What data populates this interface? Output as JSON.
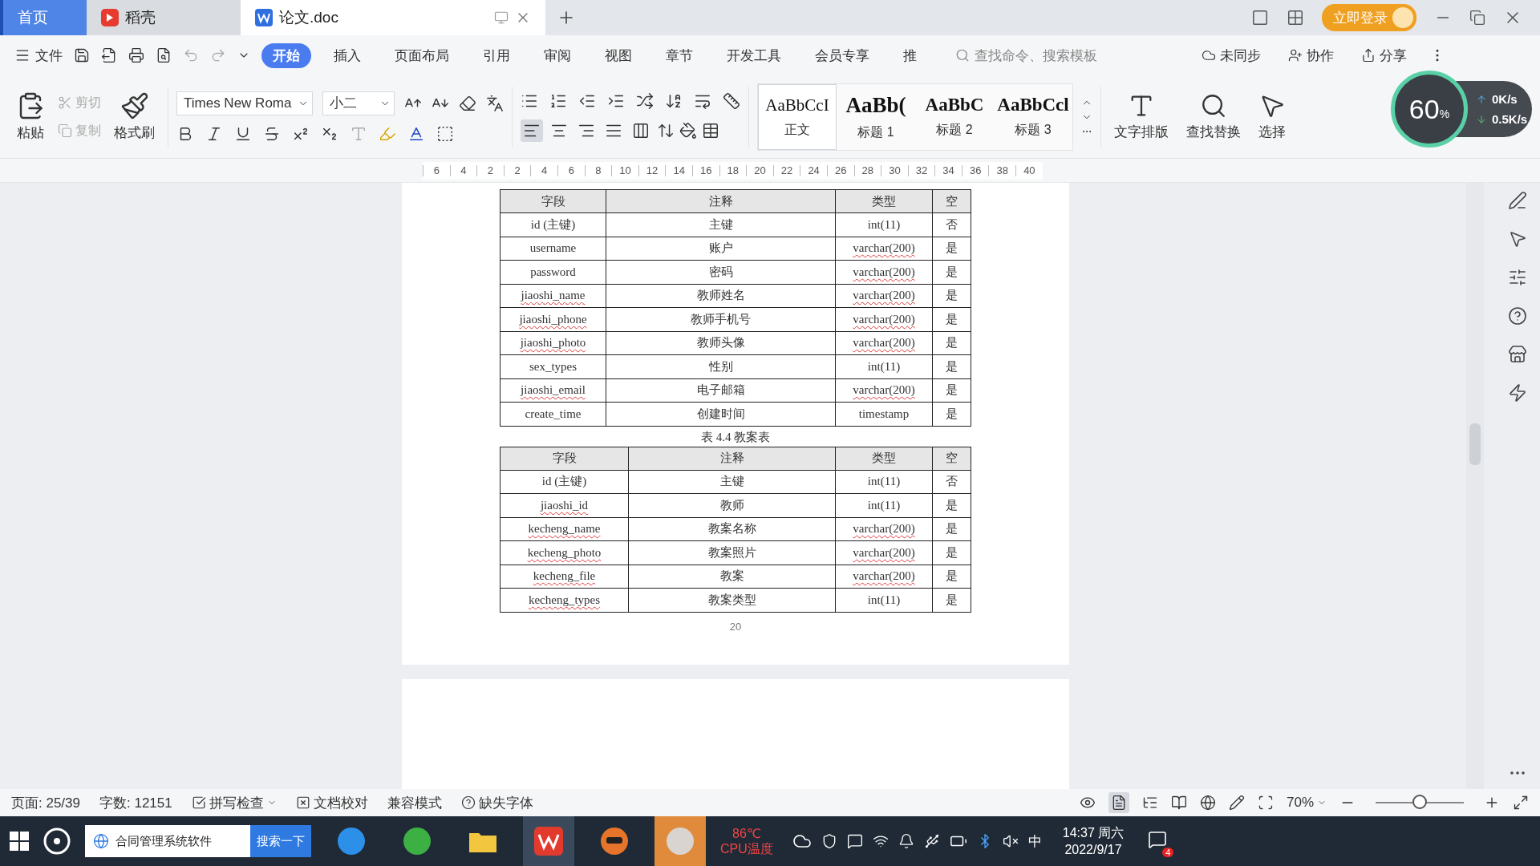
{
  "tabs": [
    {
      "label": "首页",
      "kind": "home",
      "selected": false
    },
    {
      "label": "稻壳",
      "kind": "app",
      "selected": false
    },
    {
      "label": "论文.doc",
      "kind": "doc",
      "selected": true
    }
  ],
  "login_button": "立即登录",
  "menu": {
    "file": "文件",
    "tabs": [
      {
        "label": "开始",
        "selected": true
      },
      {
        "label": "插入",
        "selected": false
      },
      {
        "label": "页面布局",
        "selected": false
      },
      {
        "label": "引用",
        "selected": false
      },
      {
        "label": "审阅",
        "selected": false
      },
      {
        "label": "视图",
        "selected": false
      },
      {
        "label": "章节",
        "selected": false
      },
      {
        "label": "开发工具",
        "selected": false
      },
      {
        "label": "会员专享",
        "selected": false
      },
      {
        "label": "推",
        "selected": false
      }
    ],
    "search_placeholder": "查找命令、搜索模板",
    "actions": [
      "未同步",
      "协作",
      "分享"
    ]
  },
  "ribbon": {
    "paste": "粘贴",
    "clipboard": [
      {
        "label": "剪切",
        "kind": "cut",
        "disabled": true
      },
      {
        "label": "复制",
        "kind": "copy",
        "disabled": true
      }
    ],
    "format_painter": "格式刷",
    "font": "Times New Roma",
    "size": "小二",
    "alignment": [
      {
        "kind": "left",
        "selected": true
      },
      {
        "kind": "center",
        "selected": false
      },
      {
        "kind": "right",
        "selected": false
      },
      {
        "kind": "justify",
        "selected": false
      },
      {
        "kind": "distributed",
        "selected": false
      }
    ],
    "styles": [
      {
        "preview": "AaBbCcI",
        "label": "正文",
        "selected": true
      },
      {
        "preview": "AaBb(",
        "label": "标题 1",
        "selected": false
      },
      {
        "preview": "AaBbC",
        "label": "标题 2",
        "selected": false
      },
      {
        "preview": "AaBbCcl",
        "label": "标题 3",
        "selected": false
      }
    ],
    "big_buttons": [
      {
        "label": "文字排版",
        "kind": "layout"
      },
      {
        "label": "查找替换",
        "kind": "find"
      },
      {
        "label": "选择",
        "kind": "select"
      }
    ]
  },
  "net_widget": {
    "percent": "60",
    "unit": "%",
    "up": "0K/s",
    "down": "0.5K/s"
  },
  "ruler": [
    "6",
    "4",
    "2",
    "2",
    "4",
    "6",
    "8",
    "10",
    "12",
    "14",
    "16",
    "18",
    "20",
    "22",
    "24",
    "26",
    "28",
    "30",
    "32",
    "34",
    "36",
    "38",
    "40"
  ],
  "tables": [
    {
      "header": [
        "字段",
        "注释",
        "类型",
        "空"
      ],
      "rows": [
        {
          "field": "id (主键)",
          "field_flagged": false,
          "note": "主键",
          "type": "int(11)",
          "type_flagged": false,
          "nullable": "否"
        },
        {
          "field": "username",
          "field_flagged": false,
          "note": "账户",
          "type": "varchar(200)",
          "type_flagged": true,
          "nullable": "是"
        },
        {
          "field": "password",
          "field_flagged": false,
          "note": "密码",
          "type": "varchar(200)",
          "type_flagged": true,
          "nullable": "是"
        },
        {
          "field": "jiaoshi_name",
          "field_flagged": true,
          "note": "教师姓名",
          "type": "varchar(200)",
          "type_flagged": true,
          "nullable": "是"
        },
        {
          "field": "jiaoshi_phone",
          "field_flagged": true,
          "note": "教师手机号",
          "type": "varchar(200)",
          "type_flagged": true,
          "nullable": "是"
        },
        {
          "field": "jiaoshi_photo",
          "field_flagged": true,
          "note": "教师头像",
          "type": "varchar(200)",
          "type_flagged": true,
          "nullable": "是"
        },
        {
          "field": "sex_types",
          "field_flagged": false,
          "note": "性别",
          "type": "int(11)",
          "type_flagged": false,
          "nullable": "是"
        },
        {
          "field": "jiaoshi_email",
          "field_flagged": true,
          "note": "电子邮箱",
          "type": "varchar(200)",
          "type_flagged": true,
          "nullable": "是"
        },
        {
          "field": "create_time",
          "field_flagged": false,
          "note": "创建时间",
          "type": "timestamp",
          "type_flagged": false,
          "nullable": "是"
        }
      ]
    },
    {
      "caption": "表 4.4  教案表",
      "header": [
        "字段",
        "注释",
        "类型",
        "空"
      ],
      "rows": [
        {
          "field": "id (主键)",
          "field_flagged": false,
          "note": "主键",
          "type": "int(11)",
          "type_flagged": false,
          "nullable": "否"
        },
        {
          "field": "jiaoshi_id",
          "field_flagged": true,
          "note": "教师",
          "type": "int(11)",
          "type_flagged": false,
          "nullable": "是"
        },
        {
          "field": "kecheng_name",
          "field_flagged": true,
          "note": "教案名称",
          "type": "varchar(200)",
          "type_flagged": true,
          "nullable": "是"
        },
        {
          "field": "kecheng_photo",
          "field_flagged": true,
          "note": "教案照片",
          "type": "varchar(200)",
          "type_flagged": true,
          "nullable": "是"
        },
        {
          "field": "kecheng_file",
          "field_flagged": true,
          "note": "教案",
          "type": "varchar(200)",
          "type_flagged": true,
          "nullable": "是"
        },
        {
          "field": "kecheng_types",
          "field_flagged": true,
          "note": "教案类型",
          "type": "int(11)",
          "type_flagged": false,
          "nullable": "是"
        }
      ]
    }
  ],
  "page_number": "20",
  "status": {
    "items": [
      "页面: 25/39",
      "字数: 12151"
    ],
    "spell": "拼写检查",
    "proof": "文档校对",
    "compat": "兼容模式",
    "fonts": "缺失字体",
    "zoom": "70%",
    "zoom_level": {
      "level": 0.5
    }
  },
  "taskbar": {
    "search_value": "合同管理系统软件",
    "search_button": "搜索一下",
    "temp": "86℃",
    "temp_label": "CPU温度",
    "ime": "中",
    "time": "14:37 周六",
    "date": "2022/9/17",
    "badge": "4"
  }
}
